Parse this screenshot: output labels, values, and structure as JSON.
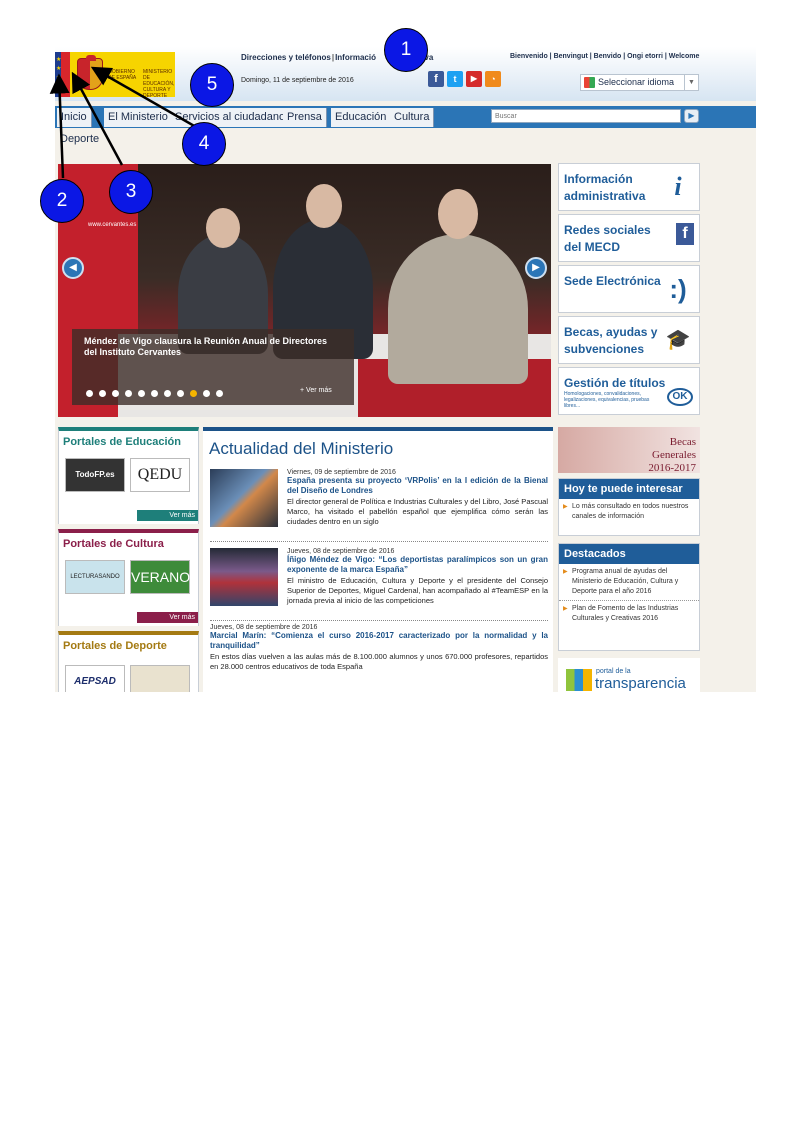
{
  "header": {
    "gov_text": "Gobierno de España",
    "ministry_text": "Ministerio de Educación, Cultura y Deporte",
    "top_links": [
      "Direcciones y teléfonos",
      "Informació",
      "iva"
    ],
    "lang_links": "Bienvenido | Benvingut | Benvido | Ongi etorri | Welcome",
    "date": "Domingo, 11 de septiembre de 2016",
    "language_select": "Seleccionar idioma",
    "social_icons": [
      "facebook-icon",
      "twitter-icon",
      "youtube-icon",
      "rss-icon"
    ],
    "flag_stars": "★\n★\n★",
    "coat_of_arms": "Escudo de España"
  },
  "nav": {
    "items": [
      "Inicio",
      "El Ministerio",
      "Servicios al ciudadano",
      "Prensa",
      "Educación",
      "Cultura"
    ],
    "second_row": "Deporte",
    "search_placeholder": "Buscar"
  },
  "slider": {
    "backdrop_text": "www.cervantes.es",
    "caption": "Méndez de Vigo clausura la Reunión Anual de Directores del Instituto Cervantes",
    "more": "+ Ver más",
    "dot_count": 11,
    "active_dot": 8
  },
  "right_boxes": [
    {
      "label": "Información administrativa",
      "icon": "info-icon",
      "glyph": "i"
    },
    {
      "label": "Redes sociales del MECD",
      "icon": "social-networks-icon",
      "glyph": "f"
    },
    {
      "label": "Sede Electrónica",
      "icon": "smiley-icon",
      "glyph": ":)"
    },
    {
      "label": "Becas, ayudas y subvenciones",
      "icon": "graduation-cap-icon",
      "glyph": "🎓"
    },
    {
      "label": "Gestión de títulos",
      "sub": "Homologaciones, convalidaciones, legalizaciones, equivalencias, pruebas libres...",
      "icon": "ok-icon",
      "glyph": "OK"
    }
  ],
  "portals": {
    "education": {
      "title": "Portales de Educación",
      "logos": [
        "TodoFP.es",
        "QEDU"
      ],
      "more": "Ver más"
    },
    "culture": {
      "title": "Portales de Cultura",
      "logos": [
        "LECTURASANDO",
        "VERANO"
      ],
      "more": "Ver más"
    },
    "sport": {
      "title": "Portales de Deporte",
      "logos": [
        "AEPSAD",
        "calendar"
      ]
    }
  },
  "news": {
    "heading": "Actualidad del Ministerio",
    "items": [
      {
        "date": "Viernes, 09 de septiembre de 2016",
        "title": "España presenta su proyecto ‘VRPolis’ en la I edición de la Bienal del Diseño de Londres",
        "text": "El director general de Política e Industrias Culturales y del Libro, José Pascual Marco, ha visitado el pabellón español que ejemplifica cómo serán las ciudades dentro en un siglo"
      },
      {
        "date": "Jueves, 08 de septiembre de 2016",
        "title": "Íñigo Méndez de Vigo: “Los deportistas paralímpicos son un gran exponente de la marca España”",
        "text": "El ministro de Educación, Cultura y Deporte y el presidente del Consejo Superior de Deportes, Miguel Cardenal, han acompañado al #TeamESP en la jornada previa al inicio de las competiciones"
      },
      {
        "date": "Jueves, 08 de septiembre de 2016",
        "title": "Marcial Marín: “Comienza el curso 2016-2017 caracterizado por la normalidad y la tranquilidad”",
        "text": "En estos días vuelven a las aulas más de 8.100.000 alumnos y unos 670.000 profesores, repartidos en 28.000 centros educativos de toda España"
      }
    ]
  },
  "sidebar": {
    "becas_banner": "Becas Generales 2016-2017",
    "interest_head": "Hoy te puede interesar",
    "interest_items": [
      "Lo más consultado en todos nuestros canales de información"
    ],
    "featured_head": "Destacados",
    "featured_items": [
      "Programa anual de ayudas del Ministerio de Educación, Cultura y Deporte para el año 2016",
      "Plan de Fomento de las Industrias Culturales y Creativas 2016"
    ],
    "transparency_small": "portal de la",
    "transparency_big": "transparencia"
  },
  "annotations": [
    "1",
    "2",
    "3",
    "4",
    "5"
  ],
  "colors": {
    "nav_blue": "#2b75b6",
    "heading_blue": "#1f5d99",
    "marker_blue": "#0b17e5",
    "education_green": "#1e7f7a",
    "culture_maroon": "#8b1f4a",
    "sport_gold": "#a47a12"
  }
}
